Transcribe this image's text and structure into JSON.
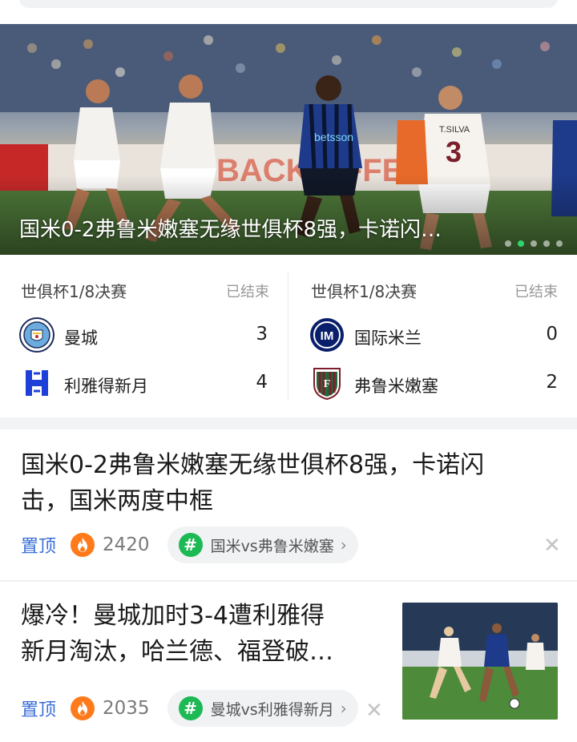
{
  "hero": {
    "title": "国米0-2弗鲁米嫩塞无缘世俱杯8强，卡诺闪…",
    "carousel_dots": 5,
    "active_dot": 1,
    "jersey_name": "T.SILVA",
    "jersey_number": "3",
    "shirt_sponsor": "betsson",
    "ad_board_text": "H BACK OFFER"
  },
  "matches": [
    {
      "round": "世俱杯1/8决赛",
      "status": "已结束",
      "home": {
        "name": "曼城",
        "score": "3",
        "logo": "man-city-crest"
      },
      "away": {
        "name": "利雅得新月",
        "score": "4",
        "logo": "al-hilal-crest"
      }
    },
    {
      "round": "世俱杯1/8决赛",
      "status": "已结束",
      "home": {
        "name": "国际米兰",
        "score": "0",
        "logo": "inter-crest"
      },
      "away": {
        "name": "弗鲁米嫩塞",
        "score": "2",
        "logo": "fluminense-crest"
      }
    }
  ],
  "news": [
    {
      "title_line1": "国米0-2弗鲁米嫩塞无缘世俱杯8强，卡诺闪",
      "title_line2": "击，国米两度中框",
      "pin_label": "置顶",
      "heat": "2420",
      "tag": "国米vs弗鲁米嫩塞"
    },
    {
      "title_line1": "爆冷！曼城加时3-4遭利雅得",
      "title_line2": "新月淘汰，哈兰德、福登破…",
      "pin_label": "置顶",
      "heat": "2035",
      "tag": "曼城vs利雅得新月"
    }
  ],
  "icons": {
    "fire": "fire-icon",
    "hash": "hash-icon",
    "chevron": "chevron-right-icon",
    "close": "close-icon"
  },
  "colors": {
    "pin": "#3b6fd6",
    "fire": "#ff7a1a",
    "hash": "#1db954",
    "active_dot": "#2fd36b"
  }
}
